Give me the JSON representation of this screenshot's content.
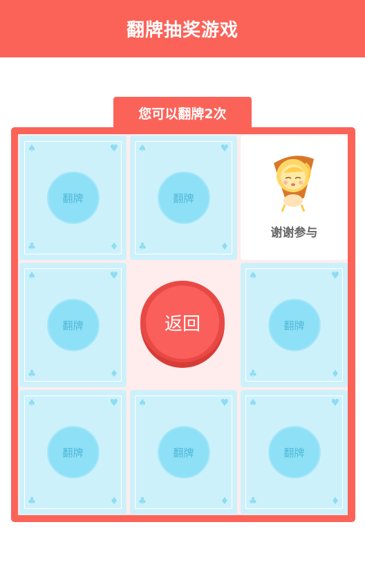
{
  "header": {
    "title": "翻牌抽奖游戏"
  },
  "chances": {
    "text": "您可以翻牌2次"
  },
  "card": {
    "flip_label": "翻牌",
    "suits": {
      "top_left": "♠",
      "top_right": "♥",
      "bottom_left": "♣",
      "bottom_right": "♦"
    }
  },
  "prize": {
    "label": "谢谢参与",
    "icon": "crying-character-icon"
  },
  "back_button": {
    "label": "返回"
  },
  "colors": {
    "primary": "#fb6359",
    "card_bg": "#cdf1fb",
    "flip_circle": "#8ee0f7",
    "board_inner": "#ffecec"
  }
}
